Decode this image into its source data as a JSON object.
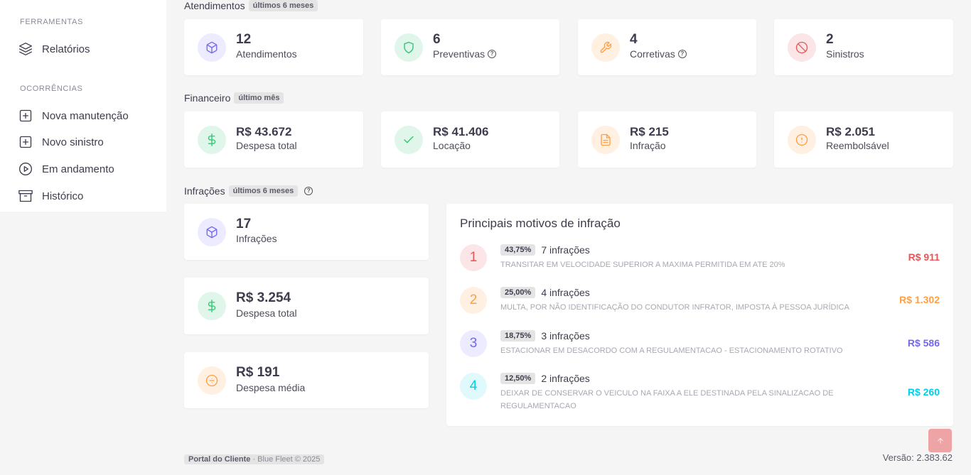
{
  "sidebar": {
    "sections": [
      {
        "title": "FERRAMENTAS",
        "items": [
          {
            "label": "Relatórios",
            "icon": "layers-icon"
          }
        ]
      },
      {
        "title": "OCORRÊNCIAS",
        "items": [
          {
            "label": "Nova manutenção",
            "icon": "plus-square-icon"
          },
          {
            "label": "Novo sinistro",
            "icon": "plus-square-icon"
          },
          {
            "label": "Em andamento",
            "icon": "play-circle-icon"
          },
          {
            "label": "Histórico",
            "icon": "archive-icon"
          }
        ]
      }
    ]
  },
  "atendimentos": {
    "title": "Atendimentos",
    "badge": "últimos 6 meses",
    "cards": [
      {
        "value": "12",
        "label": "Atendimentos",
        "icon": "box-icon",
        "color": "#7367f0"
      },
      {
        "value": "6",
        "label": "Preventivas",
        "icon": "shield-icon",
        "color": "#28c76f"
      },
      {
        "value": "4",
        "label": "Corretivas",
        "icon": "wrench-icon",
        "color": "#ff9f43"
      },
      {
        "value": "2",
        "label": "Sinistros",
        "icon": "slash-icon",
        "color": "#ea5455"
      }
    ]
  },
  "financeiro": {
    "title": "Financeiro",
    "badge": "último mês",
    "cards": [
      {
        "value": "R$ 43.672",
        "label": "Despesa total",
        "icon": "dollar-icon",
        "color": "#28c76f"
      },
      {
        "value": "R$ 41.406",
        "label": "Locação",
        "icon": "check-icon",
        "color": "#28c76f"
      },
      {
        "value": "R$ 215",
        "label": "Infração",
        "icon": "file-icon",
        "color": "#ff9f43"
      },
      {
        "value": "R$ 2.051",
        "label": "Reembolsável",
        "icon": "alert-circle-icon",
        "color": "#ff9f43"
      }
    ]
  },
  "infracoes": {
    "title": "Infrações",
    "badge": "últimos 6 meses",
    "cards": [
      {
        "value": "17",
        "label": "Infrações",
        "icon": "box-icon",
        "color": "#7367f0"
      },
      {
        "value": "R$ 3.254",
        "label": "Despesa total",
        "icon": "dollar-icon",
        "color": "#28c76f"
      },
      {
        "value": "R$ 191",
        "label": "Despesa média",
        "icon": "divide-circle-icon",
        "color": "#ff9f43"
      }
    ]
  },
  "motivos": {
    "title": "Principais motivos de infração",
    "items": [
      {
        "rank": "1",
        "pct": "43,75%",
        "count": "7 infrações",
        "desc": "TRANSITAR EM VELOCIDADE SUPERIOR A MAXIMA PERMITIDA EM ATE 20%",
        "value": "R$ 911",
        "color": "#ea5455",
        "bg": "#fce5e6"
      },
      {
        "rank": "2",
        "pct": "25,00%",
        "count": "4 infrações",
        "desc": "MULTA, POR NÃO IDENTIFICAÇÃO DO CONDUTOR INFRATOR, IMPOSTA À PESSOA JURÍDICA",
        "value": "R$ 1.302",
        "color": "#ff9f43",
        "bg": "#fff0e1"
      },
      {
        "rank": "3",
        "pct": "18,75%",
        "count": "3 infrações",
        "desc": "ESTACIONAR EM DESACORDO COM A REGULAMENTACAO - ESTACIONAMENTO ROTATIVO",
        "value": "R$ 586",
        "color": "#7367f0",
        "bg": "#ecebff"
      },
      {
        "rank": "4",
        "pct": "12,50%",
        "count": "2 infrações",
        "desc": "DEIXAR DE CONSERVAR O VEICULO NA FAIXA A ELE DESTINADA PELA SINALIZACAO DE REGULAMENTACAO",
        "value": "R$ 260",
        "color": "#00cfe8",
        "bg": "#e0f9fc"
      }
    ]
  },
  "footer": {
    "brand": "Portal do Cliente",
    "rest": " · Blue Fleet © 2025",
    "version": "Versão: 2.383.62"
  }
}
